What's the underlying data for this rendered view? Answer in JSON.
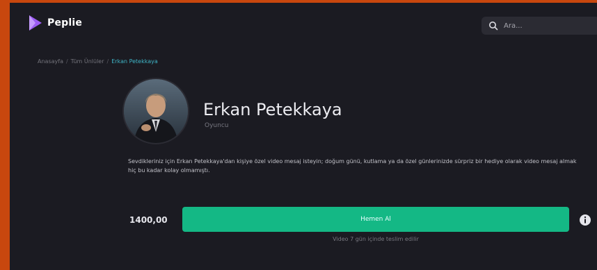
{
  "brand": {
    "name": "Peplie",
    "accent": "#9d5cf6",
    "logo_icon": "play-icon"
  },
  "header": {
    "search_placeholder": "Ara...",
    "search_icon": "search-icon"
  },
  "breadcrumb": {
    "items": [
      "Anasayfa",
      "Tüm Ünlüler"
    ],
    "separator": "/",
    "current": "Erkan Petekkaya"
  },
  "profile": {
    "name": "Erkan Petekkaya",
    "role": "Oyuncu",
    "bio": "Sevdikleriniz için Erkan Petekkaya'dan kişiye özel video mesaj isteyin; doğum günü, kutlama ya da özel günlerinizde sürpriz bir hediye olarak video mesaj almak hiç bu kadar kolay olmamıştı."
  },
  "purchase": {
    "price": "1400,00",
    "cta_label": "Hemen Al",
    "info_icon": "info-icon",
    "note": "Video 7 gün içinde teslim edilir",
    "cta_color": "#14b885"
  },
  "colors": {
    "background": "#1b1b22",
    "outer": "#c8470e",
    "link": "#3fb6c8"
  }
}
